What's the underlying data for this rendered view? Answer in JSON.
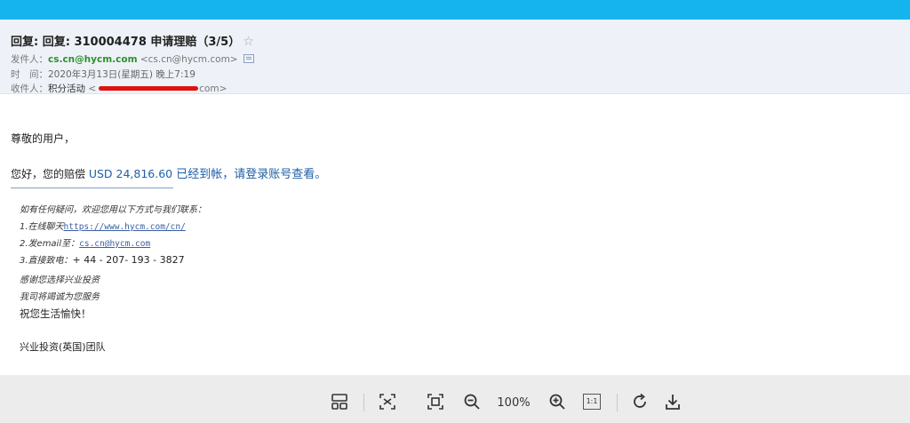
{
  "header": {
    "subject": "回复: 回复: 310004478 申请理赔（3/5）",
    "star_glyph": "☆",
    "from_label": "发件人：",
    "from_name": "cs.cn@hycm.com",
    "from_addr": "<cs.cn@hycm.com>",
    "time_label": "时　间：",
    "time_value": "2020年3月13日(星期五) 晚上7:19",
    "to_label": "收件人：",
    "to_name": "积分活动",
    "to_addr_open": "<",
    "to_addr_tail": "com>"
  },
  "body": {
    "greeting": "尊敬的用户，",
    "notice_prefix": "您好，您的赔偿 ",
    "notice_amount": "USD 24,816.60",
    "notice_suffix": " 已经到帐，请登录账号查看。",
    "contact_intro": "如有任何疑问，欢迎您用以下方式与我们联系：",
    "line1_prefix": "1.在线聊天",
    "line1_link": "https://www.hycm.com/cn/",
    "line2_prefix": "2.发email至：",
    "line2_link": "cs.cn@hycm.com",
    "line3_prefix": "3.直接致电：",
    "line3_phone": "+ 44 - 207- 193 - 3827",
    "thanks": "感谢您选择兴业投资",
    "serve": "我司将竭诚为您服务",
    "wish": "祝您生活愉快！",
    "team": "兴业投资(英国)团队"
  },
  "toolbar": {
    "zoom": "100%",
    "actual_size": "1:1"
  },
  "colors": {
    "top_bar": "#16b4ef",
    "header_bg": "#eef2f8",
    "sender_green": "#2f8f2f",
    "link_blue": "#1f5fa8",
    "redaction": "#e01010"
  }
}
